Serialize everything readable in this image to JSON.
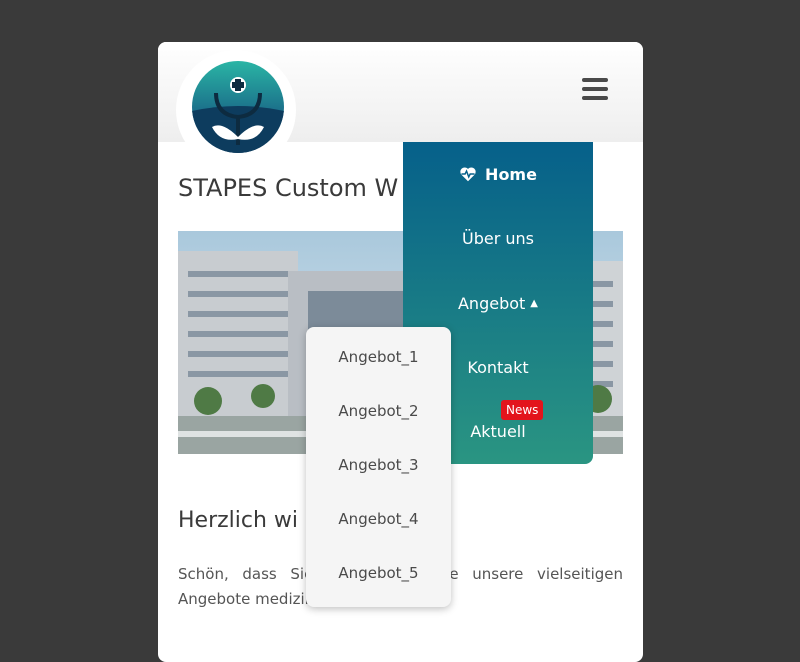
{
  "brand": {
    "logo_icon": "stethoscope-leaf-logo",
    "colors": {
      "teal": "#2ab5a5",
      "navy": "#0d3c5e"
    }
  },
  "header": {
    "menu_icon": "hamburger-icon"
  },
  "page": {
    "title": "STAPES Custom W",
    "hero_icon": "hospital-building-image",
    "section_heading": "Herzlich wi",
    "intro_text": "Schön, dass Sie  en Ihnen gerne unsere vielseitigen Angebote  medizinische Praxis vor."
  },
  "nav": {
    "colors": {
      "top": "#06608a",
      "bottom": "#2a9582"
    },
    "items": [
      {
        "label": "Home",
        "icon": "heartbeat-icon",
        "active": true
      },
      {
        "label": "Über uns"
      },
      {
        "label": "Angebot",
        "caret": "▲"
      },
      {
        "label": "Kontakt"
      },
      {
        "label": "Aktuell",
        "badge": "News"
      }
    ],
    "badge_color": "#e3141c"
  },
  "dropdown": {
    "items": [
      "Angebot_1",
      "Angebot_2",
      "Angebot_3",
      "Angebot_4",
      "Angebot_5"
    ]
  }
}
